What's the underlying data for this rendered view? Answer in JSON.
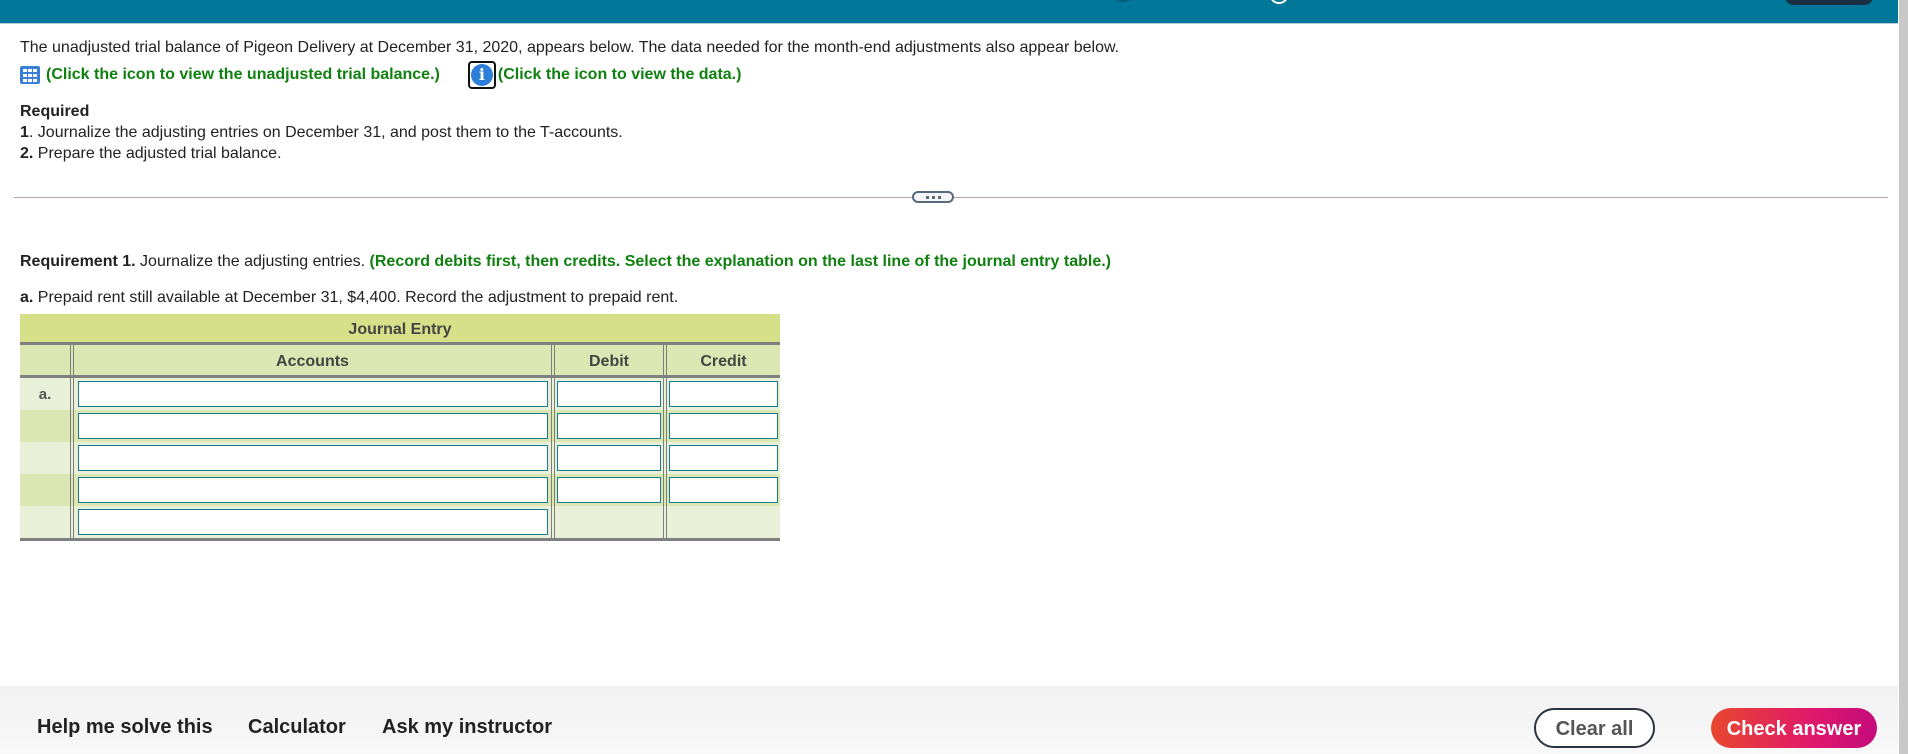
{
  "header": {
    "icons": [
      "step-indicator-icon",
      "progress-ring-icon",
      "header-menu-button"
    ]
  },
  "intro": {
    "text": "The unadjusted trial balance of Pigeon Delivery at December 31, 2020, appears below. The data needed for the month-end adjustments also appear below.",
    "trial_balance_link": "(Click the icon to view the unadjusted trial balance.)",
    "data_link": "(Click the icon to view the data.)",
    "icons": {
      "trial_balance": "table-grid-icon",
      "data": "info-icon"
    },
    "colors": {
      "link": "#108010",
      "icon": "#2d7ed8"
    }
  },
  "required": {
    "heading": "Required",
    "items": [
      {
        "num": "1",
        "sep": ". ",
        "text": "Journalize the adjusting entries on December 31, and post them to the T-accounts."
      },
      {
        "num": "2.",
        "sep": " ",
        "text": "Prepare the adjusted trial balance."
      }
    ]
  },
  "expander": {
    "icon": "more-dots-icon"
  },
  "requirement1": {
    "label": "Requirement 1.",
    "text": "Journalize the adjusting entries.",
    "instruction": "(Record debits first, then credits. Select the explanation on the last line of the journal entry table.)"
  },
  "part_a": {
    "label": "a.",
    "text": "Prepaid rent still available at December 31, $4,400. Record the adjustment to prepaid rent."
  },
  "journal": {
    "title": "Journal Entry",
    "columns": [
      "",
      "Accounts",
      "Debit",
      "Credit"
    ],
    "rows": [
      {
        "label": "a.",
        "account": "",
        "debit": "",
        "credit": ""
      },
      {
        "label": "",
        "account": "",
        "debit": "",
        "credit": ""
      },
      {
        "label": "",
        "account": "",
        "debit": "",
        "credit": ""
      },
      {
        "label": "",
        "account": "",
        "debit": "",
        "credit": ""
      },
      {
        "label": "",
        "explanation": ""
      }
    ],
    "colors": {
      "title_bg": "#d5e088",
      "header_bg": "#dbe6b2",
      "row_light": "#e8f1d8",
      "input_border": "#157a92"
    }
  },
  "footer": {
    "help": "Help me solve this",
    "calculator": "Calculator",
    "ask": "Ask my instructor",
    "clear": "Clear all",
    "check": "Check answer",
    "colors": {
      "check_start": "#e8472f",
      "check_end": "#c40a7c"
    }
  },
  "theme": {
    "topbar": "#007698"
  }
}
